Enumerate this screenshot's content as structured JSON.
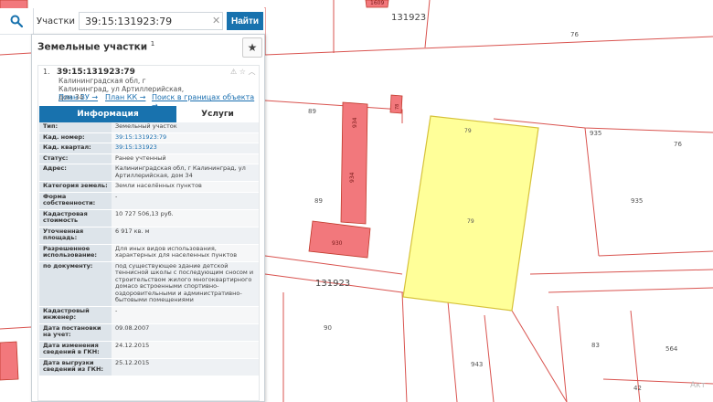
{
  "toolbar": {
    "mode_label": "Участки",
    "query_value": "39:15:131923:79",
    "find_label": "Найти"
  },
  "panel": {
    "title": "Земельные участки",
    "title_count": "1"
  },
  "card": {
    "index": "1.",
    "kad_number": "39:15:131923:79",
    "address": "Калининградская обл, г Калининград, ул Артиллерийская, дом 34",
    "links": {
      "plan_zu": "План ЗУ →",
      "plan_kk": "План КК →",
      "search_bounds": "Поиск в границах объекта →"
    },
    "tabs": {
      "info": "Информация",
      "services": "Услуги"
    },
    "attributes": [
      {
        "label": "Тип:",
        "value": "Земельный участок",
        "link": false
      },
      {
        "label": "Кад. номер:",
        "value": "39:15:131923:79",
        "link": true
      },
      {
        "label": "Кад. квартал:",
        "value": "39:15:131923",
        "link": true
      },
      {
        "label": "Статус:",
        "value": "Ранее учтенный",
        "link": false
      },
      {
        "label": "Адрес:",
        "value": "Калининградская обл, г Калининград, ул Артиллерийская, дом 34",
        "link": false
      },
      {
        "label": "Категория земель:",
        "value": "Земли населённых пунктов",
        "link": false
      },
      {
        "label": "Форма собственности:",
        "value": "-",
        "link": false
      },
      {
        "label": "Кадастровая стоимость",
        "value": "10 727 506,13 руб.",
        "link": false
      },
      {
        "label": "Уточненная площадь:",
        "value": "6 917 кв. м",
        "link": false
      },
      {
        "label": "Разрешенное использование:",
        "value": "Для иных видов использования, характерных для населенных пунктов",
        "link": false
      },
      {
        "label": "по документу:",
        "value": "под существующее здание детской теннисной школы с последующим сносом и строительством жилого многоквартирного домаcо встроенными спортивно-оздоровительными и административно-бытовыми помещениями",
        "link": false
      },
      {
        "label": "Кадастровый инженер:",
        "value": "-",
        "link": false
      },
      {
        "label": "Дата постановки на учет:",
        "value": "09.08.2007",
        "link": false
      },
      {
        "label": "Дата изменения сведений в ГКН:",
        "value": "24.12.2015",
        "link": false
      },
      {
        "label": "Дата выгрузки сведений из ГКН:",
        "value": "25.12.2015",
        "link": false
      }
    ]
  },
  "map": {
    "labels": {
      "block_top": "131923",
      "block_mid": "131923",
      "n1609": "1609",
      "n76a": "76",
      "n76b": "76",
      "n935a": "935",
      "n935b": "935",
      "n89a": "89",
      "n89b": "89",
      "n934a": "934",
      "n934b": "934",
      "n78": "78",
      "n79a": "79",
      "n79b": "79",
      "n930": "930",
      "n90": "90",
      "n943": "943",
      "n83": "83",
      "n564": "564",
      "n42": "42"
    },
    "colors": {
      "boundary": "#d9534f",
      "building": "#f2787c",
      "selected": "#ffff99",
      "selected_border": "#d6c23a"
    }
  },
  "watermark": "Акт"
}
